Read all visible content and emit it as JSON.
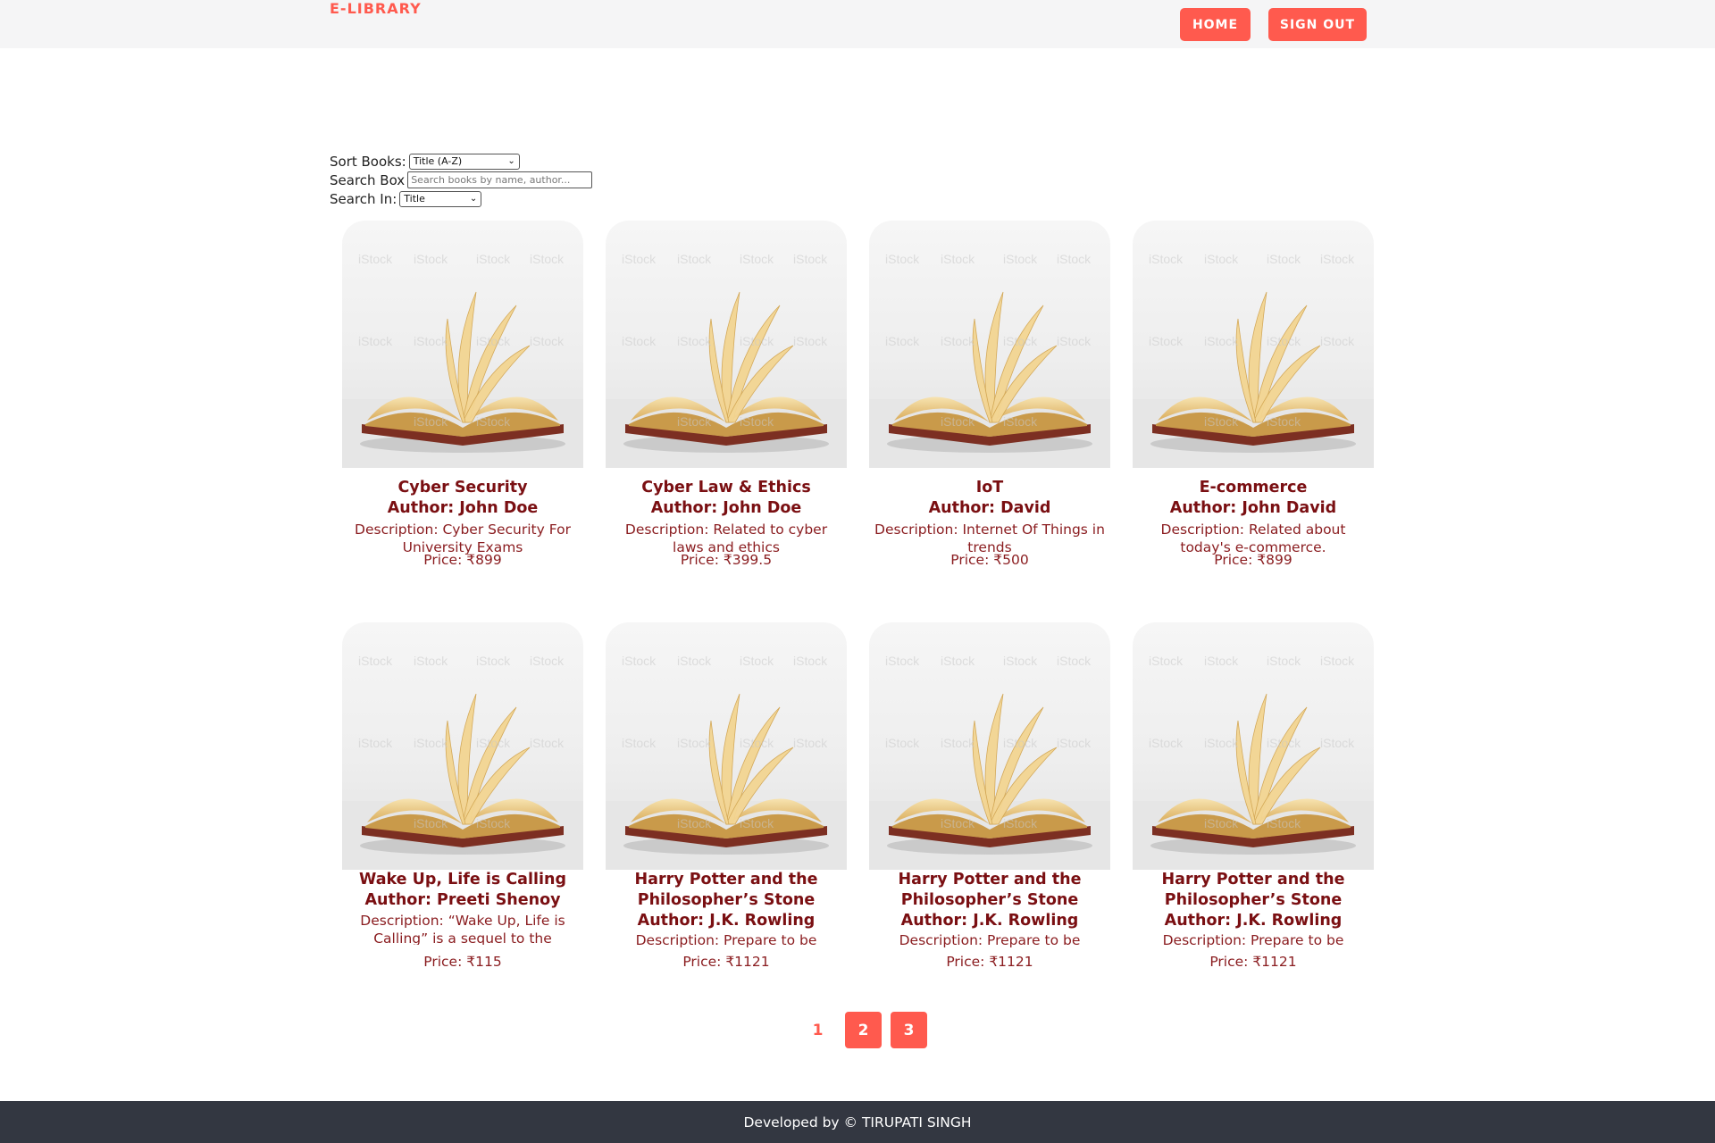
{
  "header": {
    "brand": "E-LIBRARY",
    "nav": {
      "home_label": "HOME",
      "signout_label": "SIGN OUT"
    }
  },
  "controls": {
    "sort_label": "Sort Books:",
    "sort_selected": "Title (A-Z)",
    "search_label": "Search Box",
    "search_placeholder": "Search books by name, author...",
    "search_value": "",
    "search_in_label": "Search In:",
    "search_in_selected": "Title"
  },
  "books": [
    {
      "title": "Cyber Security",
      "author": "Author: John Doe",
      "description": "Description: Cyber Security For University Exams",
      "price": "Price: ₹899"
    },
    {
      "title": "Cyber Law & Ethics",
      "author": "Author: John Doe",
      "description": "Description: Related to cyber laws and ethics",
      "price": "Price: ₹399.5"
    },
    {
      "title": "IoT",
      "author": "Author: David",
      "description": "Description: Internet Of Things in trends",
      "price": "Price: ₹500"
    },
    {
      "title": "E-commerce",
      "author": "Author: John David",
      "description": "Description: Related about today's e-commerce.",
      "price": "Price: ₹899"
    },
    {
      "title": "Wake Up, Life is Calling",
      "author": "Author: Preeti Shenoy",
      "description": "Description: “Wake Up, Life is Calling” is a sequel to the",
      "price": "Price: ₹115"
    },
    {
      "title": "Harry Potter and the Philosopher’s Stone",
      "author": "Author: J.K. Rowling",
      "description": "Description: Prepare to be",
      "price": "Price: ₹1121"
    },
    {
      "title": "Harry Potter and the Philosopher’s Stone",
      "author": "Author: J.K. Rowling",
      "description": "Description: Prepare to be",
      "price": "Price: ₹1121"
    },
    {
      "title": "Harry Potter and the Philosopher’s Stone",
      "author": "Author: J.K. Rowling",
      "description": "Description: Prepare to be",
      "price": "Price: ₹1121"
    }
  ],
  "pagination": {
    "pages": [
      "1",
      "2",
      "3"
    ],
    "current": "1"
  },
  "footer": {
    "text": "Developed by © TIRUPATI SINGH"
  },
  "colors": {
    "accent": "#ff5a4e",
    "title_text": "#7a0f12",
    "body_text": "#8a1c1f",
    "footer_bg": "#333741",
    "header_bg": "#f5f5f6"
  },
  "icons": {
    "cover_image": "open-book-image"
  }
}
